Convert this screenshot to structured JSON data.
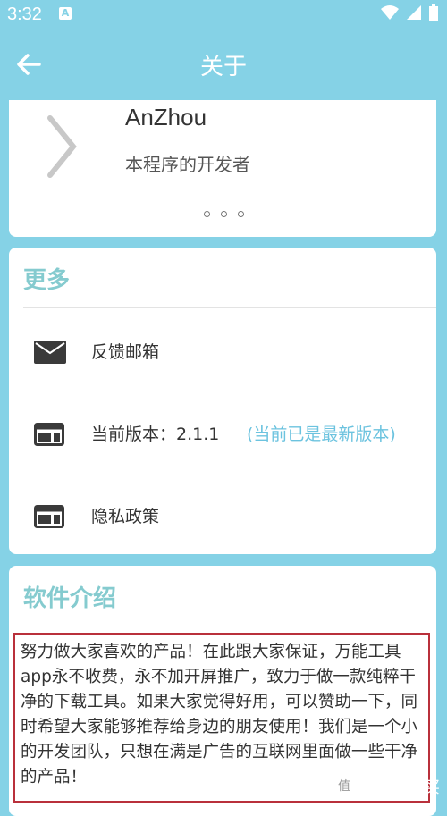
{
  "status_bar": {
    "time": "3:32",
    "notification": "A"
  },
  "app_bar": {
    "title": "关于"
  },
  "developer": {
    "name": "AnZhou",
    "role": "本程序的开发者"
  },
  "more": {
    "title": "更多",
    "items": [
      {
        "label": "反馈邮箱",
        "icon": "mail-icon"
      },
      {
        "label": "当前版本：2.1.1",
        "note": "(当前已是最新版本)",
        "icon": "window-icon"
      },
      {
        "label": "隐私政策",
        "icon": "window-icon"
      }
    ]
  },
  "intro": {
    "title": "软件介绍",
    "text": "努力做大家喜欢的产品！在此跟大家保证，万能工具app永不收费，永不加开屏推广，致力于做一款纯粹干净的下载工具。如果大家觉得好用，可以赞助一下，同时希望大家能够推荐给身边的朋友使用！我们是一个小的开发团队，只想在满是广告的互联网里面做一些干净的产品！"
  },
  "watermark": {
    "text": "什么值得买",
    "logo": "值"
  },
  "colors": {
    "primary": "#85d2e6",
    "accent_text": "#85cbcf",
    "link": "#6cc3df",
    "highlight_border": "#b9303b"
  }
}
